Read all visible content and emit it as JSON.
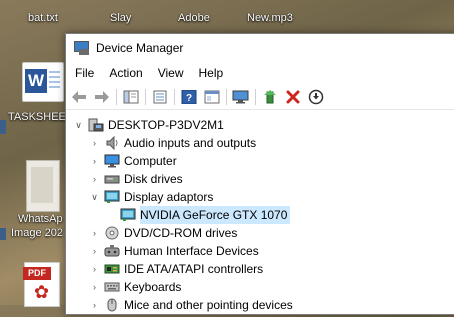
{
  "desktop": {
    "icons_top": [
      "bat.txt",
      "Slay",
      "Adobe",
      "New.mp3"
    ],
    "word_label": "TASKSHEE",
    "whatsapp_label_1": "WhatsAp",
    "whatsapp_label_2": "Image 202",
    "pdf_tag": "PDF"
  },
  "window": {
    "title": "Device Manager",
    "menu": [
      "File",
      "Action",
      "View",
      "Help"
    ],
    "toolbar_icons": [
      "back-arrow-icon",
      "forward-arrow-icon",
      "show-hide-tree-icon",
      "properties-icon",
      "help-icon",
      "view-icon",
      "scan-hardware-icon",
      "update-driver-icon",
      "uninstall-icon",
      "disable-device-icon"
    ]
  },
  "tree": {
    "root": "DESKTOP-P3DV2M1",
    "items": [
      {
        "label": "Audio inputs and outputs",
        "expanded": false,
        "icon": "speaker-icon"
      },
      {
        "label": "Computer",
        "expanded": false,
        "icon": "monitor-icon"
      },
      {
        "label": "Disk drives",
        "expanded": false,
        "icon": "disk-drive-icon"
      },
      {
        "label": "Display adaptors",
        "expanded": true,
        "icon": "display-adapter-icon"
      },
      {
        "label": "NVIDIA GeForce GTX 1070",
        "child": true,
        "selected": true,
        "icon": "display-adapter-icon"
      },
      {
        "label": "DVD/CD-ROM drives",
        "expanded": false,
        "icon": "dvd-icon"
      },
      {
        "label": "Human Interface Devices",
        "expanded": false,
        "icon": "hid-icon"
      },
      {
        "label": "IDE ATA/ATAPI controllers",
        "expanded": false,
        "icon": "ide-controller-icon"
      },
      {
        "label": "Keyboards",
        "expanded": false,
        "icon": "keyboard-icon"
      },
      {
        "label": "Mice and other pointing devices",
        "expanded": false,
        "icon": "mouse-icon"
      }
    ]
  },
  "colors": {
    "selection": "#cce8ff",
    "accent": "#2b579a",
    "uninstall_red": "#d0231c",
    "update_green": "#2e9e3a"
  }
}
